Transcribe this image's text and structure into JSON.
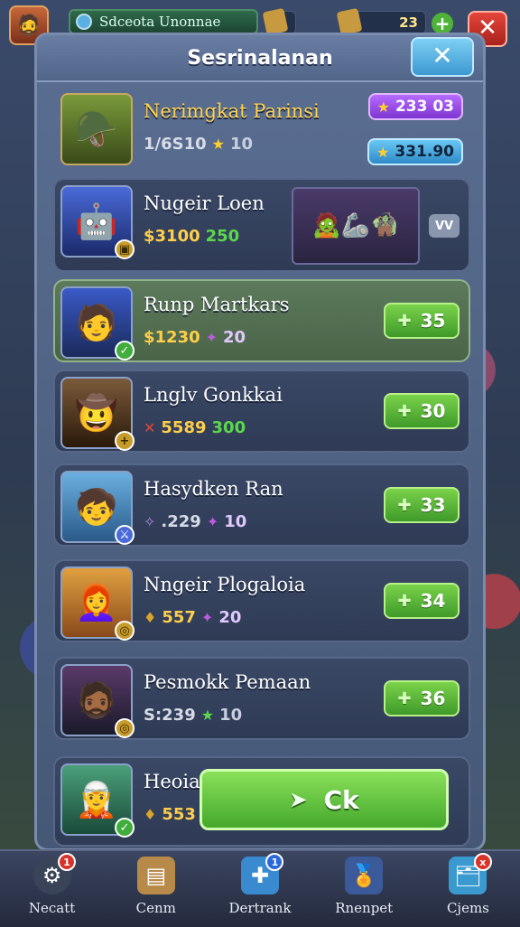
{
  "topbar": {
    "player_name": "Sdcеota Unonnae",
    "resource_count": "23",
    "avatar_icon": "warrior-portrait-icon",
    "plus_icon": "plus-icon",
    "close_icon": "close-icon"
  },
  "panel": {
    "title": "Sesrinalanan",
    "close_label": "✕"
  },
  "featured": {
    "name": "Nerimgkat Parinsi",
    "stat_primary": "1/6S10",
    "stat_secondary": "10",
    "pill_top": "233 03",
    "pill_bottom": "331.90"
  },
  "promo": {
    "name": "Nugeir Loen",
    "stat_primary": "$3100",
    "stat_secondary": "250",
    "tag": "VV"
  },
  "heroes": [
    {
      "name": "Runp Martkars",
      "stat_primary": "$1230",
      "stat_secondary": "20",
      "price": "35"
    },
    {
      "name": "Lnglv Gonkkai",
      "stat_primary": "5589",
      "stat_secondary": "300",
      "price": "30"
    },
    {
      "name": "Hasydken Ran",
      "stat_primary": ".229",
      "stat_secondary": "10",
      "price": "33"
    },
    {
      "name": "Nngeir Plogaloia",
      "stat_primary": "557",
      "stat_secondary": "20",
      "price": "34"
    },
    {
      "name": "Pesmokk Pemaan",
      "stat_primary": "S:239",
      "stat_secondary": "10",
      "price": "36"
    },
    {
      "name": "Heoia",
      "stat_primary": "553"
    }
  ],
  "ok_button": {
    "label": "Ck"
  },
  "nav": [
    {
      "label": "Necatt",
      "badge": "1"
    },
    {
      "label": "Cenm"
    },
    {
      "label": "Dertrank",
      "badge": "1"
    },
    {
      "label": "Rnenpet"
    },
    {
      "label": "Cjems",
      "badge": "x"
    }
  ],
  "colors": {
    "accent_green": "#4fb33a",
    "close_red": "#e4453a",
    "panel_blue": "#52668a"
  }
}
